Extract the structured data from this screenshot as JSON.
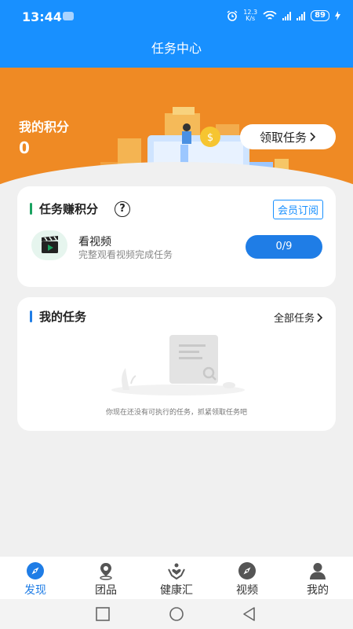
{
  "status": {
    "time": "13:44",
    "net_speed_top": "12.3",
    "net_speed_bottom": "K/s",
    "battery": "89"
  },
  "header": {
    "title": "任务中心"
  },
  "points": {
    "label": "我的积分",
    "value": "0",
    "claim_label": "领取任务"
  },
  "earn": {
    "title": "任务赚积分",
    "help": "?",
    "vip_label": "会员订阅",
    "task": {
      "name": "看视频",
      "desc": "完整观看视频完成任务",
      "progress": "0/9"
    }
  },
  "mytasks": {
    "title": "我的任务",
    "all_label": "全部任务",
    "empty_text": "你现在还没有可执行的任务，抓紧领取任务吧"
  },
  "tabs": [
    {
      "label": "发现",
      "icon": "compass-icon",
      "active": true
    },
    {
      "label": "团品",
      "icon": "location-pin-icon",
      "active": false
    },
    {
      "label": "健康汇",
      "icon": "heart-hands-icon",
      "active": false
    },
    {
      "label": "视频",
      "icon": "compass-icon",
      "active": false
    },
    {
      "label": "我的",
      "icon": "user-icon",
      "active": false
    }
  ],
  "colors": {
    "primary": "#1890ff",
    "banner": "#ef8a24",
    "progress_button": "#1f7de6",
    "accent_green": "#1aa260"
  }
}
